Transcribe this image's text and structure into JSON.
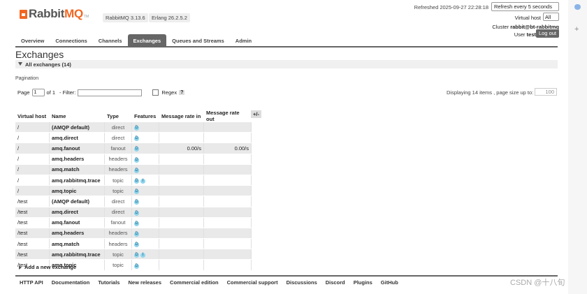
{
  "header": {
    "logo": {
      "rabbit": "Rabbit",
      "mq": "MQ",
      "tm": "TM"
    },
    "rabbitmq_version": "RabbitMQ 3.13.6",
    "erlang_version": "Erlang 26.2.5.2",
    "refreshed": "Refreshed 2025-09-27 22:28:18",
    "refresh_option": "Refresh every 5 seconds",
    "vhost_label": "Virtual host",
    "vhost_value": "All",
    "cluster_label": "Cluster",
    "cluster_value": "rabbit@bt-rabbitmq",
    "user_label": "User",
    "user_value": "test",
    "logout": "Log out"
  },
  "nav": {
    "tabs": [
      {
        "label": "Overview",
        "active": false
      },
      {
        "label": "Connections",
        "active": false
      },
      {
        "label": "Channels",
        "active": false
      },
      {
        "label": "Exchanges",
        "active": true
      },
      {
        "label": "Queues and Streams",
        "active": false
      },
      {
        "label": "Admin",
        "active": false
      }
    ]
  },
  "main": {
    "title": "Exchanges",
    "section": "All exchanges (14)",
    "pagination_label": "Pagination",
    "page_label": "Page",
    "page_value": "1",
    "of_label": "of 1",
    "filter_label": "- Filter:",
    "regex_label": "Regex",
    "help": "?",
    "displaying": "Displaying 14 items , page size up to:",
    "page_size": "100"
  },
  "table": {
    "columns": [
      "Virtual host",
      "Name",
      "Type",
      "Features",
      "Message rate in",
      "Message rate out"
    ],
    "plusminus": "+/-",
    "rows": [
      {
        "vhost": "/",
        "name": "(AMQP default)",
        "type": "direct",
        "features": [
          "D"
        ],
        "rate_in": "",
        "rate_out": ""
      },
      {
        "vhost": "/",
        "name": "amq.direct",
        "type": "direct",
        "features": [
          "D"
        ],
        "rate_in": "",
        "rate_out": ""
      },
      {
        "vhost": "/",
        "name": "amq.fanout",
        "type": "fanout",
        "features": [
          "D"
        ],
        "rate_in": "0.00/s",
        "rate_out": "0.00/s"
      },
      {
        "vhost": "/",
        "name": "amq.headers",
        "type": "headers",
        "features": [
          "D"
        ],
        "rate_in": "",
        "rate_out": ""
      },
      {
        "vhost": "/",
        "name": "amq.match",
        "type": "headers",
        "features": [
          "D"
        ],
        "rate_in": "",
        "rate_out": ""
      },
      {
        "vhost": "/",
        "name": "amq.rabbitmq.trace",
        "type": "topic",
        "features": [
          "D",
          "I"
        ],
        "rate_in": "",
        "rate_out": ""
      },
      {
        "vhost": "/",
        "name": "amq.topic",
        "type": "topic",
        "features": [
          "D"
        ],
        "rate_in": "",
        "rate_out": ""
      },
      {
        "vhost": "/test",
        "name": "(AMQP default)",
        "type": "direct",
        "features": [
          "D"
        ],
        "rate_in": "",
        "rate_out": ""
      },
      {
        "vhost": "/test",
        "name": "amq.direct",
        "type": "direct",
        "features": [
          "D"
        ],
        "rate_in": "",
        "rate_out": ""
      },
      {
        "vhost": "/test",
        "name": "amq.fanout",
        "type": "fanout",
        "features": [
          "D"
        ],
        "rate_in": "",
        "rate_out": ""
      },
      {
        "vhost": "/test",
        "name": "amq.headers",
        "type": "headers",
        "features": [
          "D"
        ],
        "rate_in": "",
        "rate_out": ""
      },
      {
        "vhost": "/test",
        "name": "amq.match",
        "type": "headers",
        "features": [
          "D"
        ],
        "rate_in": "",
        "rate_out": ""
      },
      {
        "vhost": "/test",
        "name": "amq.rabbitmq.trace",
        "type": "topic",
        "features": [
          "D",
          "I"
        ],
        "rate_in": "",
        "rate_out": ""
      },
      {
        "vhost": "/test",
        "name": "amq.topic",
        "type": "topic",
        "features": [
          "D"
        ],
        "rate_in": "",
        "rate_out": ""
      }
    ]
  },
  "add_exchange": "Add a new exchange",
  "footer": {
    "links": [
      "HTTP API",
      "Documentation",
      "Tutorials",
      "New releases",
      "Commercial edition",
      "Commercial support",
      "Discussions",
      "Discord",
      "Plugins",
      "GitHub"
    ]
  },
  "watermark": "CSDN @十八旬",
  "rail": {
    "plus": "+"
  },
  "colors": {
    "brand": "#f26722",
    "nav_active": "#666666",
    "badge": "#8fd4ed"
  }
}
